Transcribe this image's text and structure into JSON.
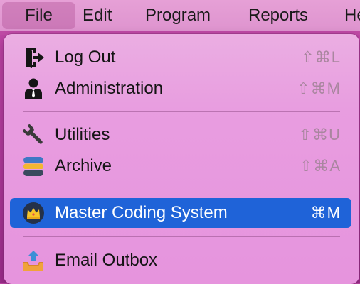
{
  "menubar": {
    "items": [
      {
        "label": "File",
        "active": true
      },
      {
        "label": "Edit"
      },
      {
        "label": "Program"
      },
      {
        "label": "Reports"
      },
      {
        "label": "He"
      }
    ]
  },
  "file_menu": {
    "items": [
      {
        "label": "Log Out",
        "shortcut": "⇧⌘L",
        "icon": "logout-door-icon"
      },
      {
        "label": "Administration",
        "shortcut": "⇧⌘M",
        "icon": "administrator-person-icon"
      },
      {
        "label": "Utilities",
        "shortcut": "⇧⌘U",
        "icon": "wrench-icon"
      },
      {
        "label": "Archive",
        "shortcut": "⇧⌘A",
        "icon": "database-stack-icon"
      },
      {
        "label": "Master Coding System",
        "shortcut": "⌘M",
        "icon": "crown-icon",
        "highlighted": true
      },
      {
        "label": "Email Outbox",
        "shortcut": "",
        "icon": "outbox-tray-icon"
      }
    ]
  },
  "colors": {
    "highlight": "#1f63d8",
    "menu_background": "#e89de0",
    "shortcut_text": "#a9869f",
    "desktop_background": "#b23c9c"
  }
}
